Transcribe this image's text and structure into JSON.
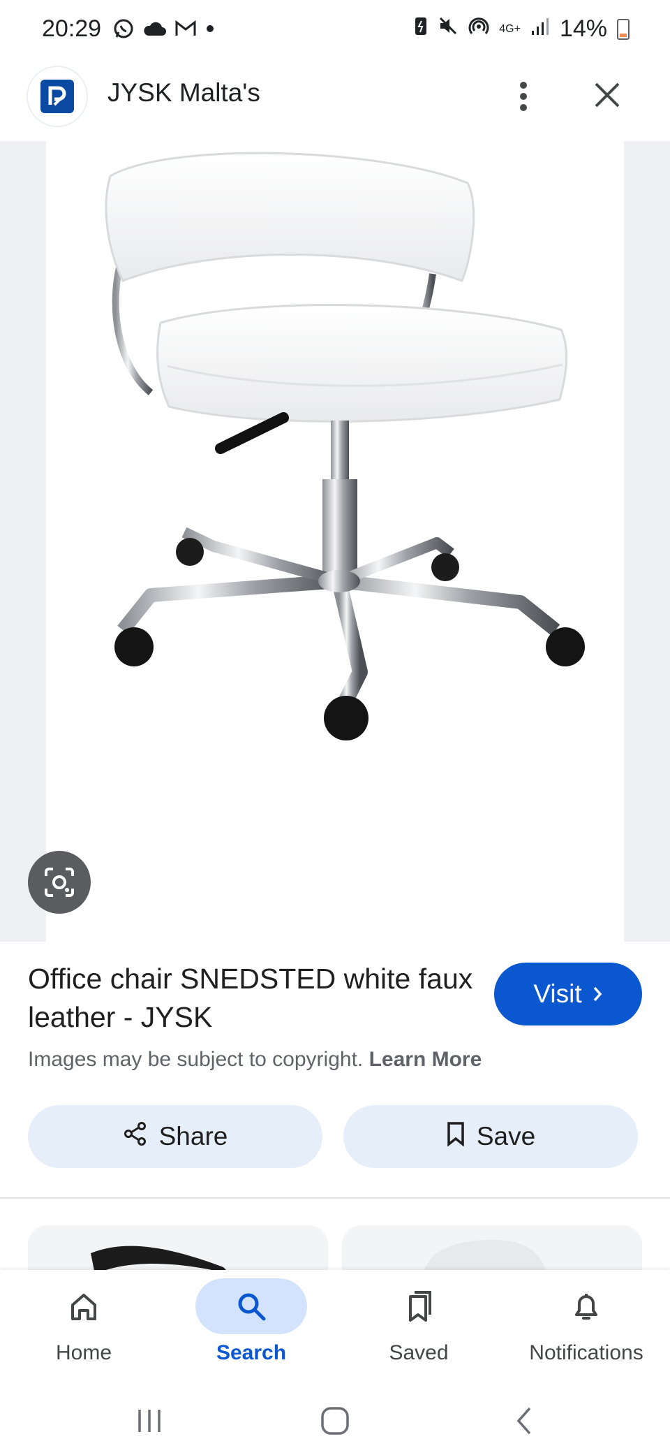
{
  "status_bar": {
    "time": "20:29",
    "network": "4G+",
    "battery": "14%",
    "left_icons": [
      "whatsapp-icon",
      "cloud-icon",
      "gmail-icon",
      "dot-icon"
    ],
    "right_icons": [
      "battery-saver-icon",
      "mute-icon",
      "hotspot-icon",
      "network-arrows-icon",
      "signal-icon"
    ]
  },
  "header": {
    "title": "JYSK Malta's",
    "logo_icon": "site-logo-icon",
    "more_icon": "more-vert-icon",
    "close_icon": "close-icon"
  },
  "image": {
    "subject": "white office chair with chrome base",
    "lens_icon": "google-lens-icon"
  },
  "result": {
    "title": "Office chair SNEDSTED white faux leather - JYSK",
    "visit_label": "Visit",
    "copyright_text": "Images may be subject to copyright.",
    "learn_more": "Learn More"
  },
  "actions": {
    "share_label": "Share",
    "save_label": "Save"
  },
  "bottom_nav": {
    "items": [
      {
        "label": "Home",
        "icon": "home-icon",
        "active": false
      },
      {
        "label": "Search",
        "icon": "search-icon",
        "active": true
      },
      {
        "label": "Saved",
        "icon": "saved-icon",
        "active": false
      },
      {
        "label": "Notifications",
        "icon": "bell-icon",
        "active": false
      }
    ]
  },
  "colors": {
    "accent": "#0b57d0",
    "accent_light": "#d3e3fd",
    "chip_bg": "#e6eef9",
    "text_secondary": "#5f6368"
  }
}
